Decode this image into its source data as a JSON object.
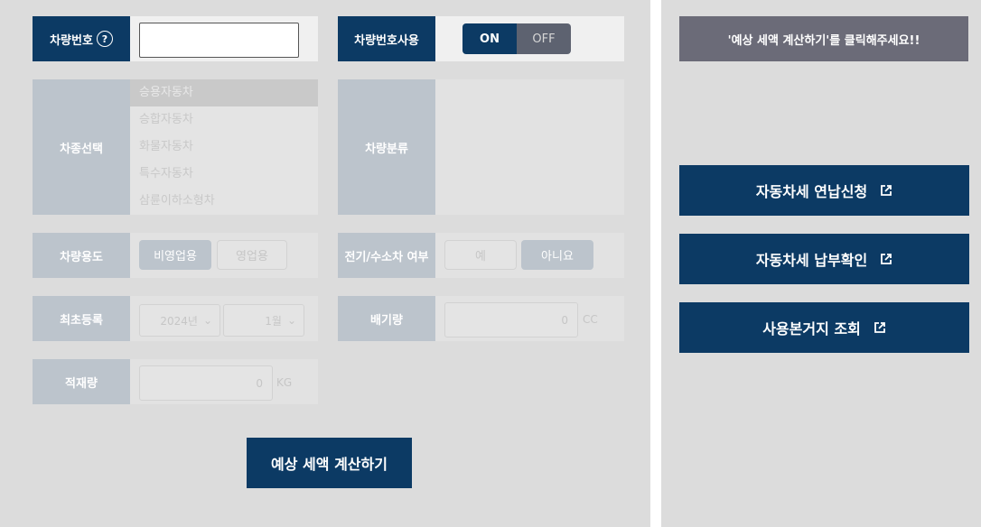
{
  "form": {
    "plate_label": "차량번호",
    "plate_value": "",
    "help_icon": "question-circle-icon",
    "use_plate_label": "차량번호사용",
    "toggle_on": "ON",
    "toggle_off": "OFF",
    "toggle_state": "ON",
    "car_type_label": "차종선택",
    "car_types": [
      "승용자동차",
      "승합자동차",
      "화물자동차",
      "특수자동차",
      "삼륜이하소형차"
    ],
    "car_type_selected": "승용자동차",
    "car_class_label": "차량분류",
    "purpose_label": "차량용도",
    "purpose_options": [
      "비영업용",
      "영업용"
    ],
    "purpose_selected": "비영업용",
    "ev_label": "전기/수소차 여부",
    "ev_options": [
      "예",
      "아니요"
    ],
    "ev_selected": "아니요",
    "first_reg_label": "최초등록",
    "year_value": "2024년",
    "month_value": "1월",
    "displacement_label": "배기량",
    "displacement_value": "0",
    "displacement_unit": "CC",
    "load_label": "적재량",
    "load_value": "0",
    "load_unit": "KG",
    "calc_button": "예상 세액 계산하기"
  },
  "sidebar": {
    "notice": "'예상 세액 계산하기'를 클릭해주세요!!",
    "links": [
      {
        "label": "자동차세 연납신청",
        "icon": "external-link-icon"
      },
      {
        "label": "자동차세 납부확인",
        "icon": "external-link-icon"
      },
      {
        "label": "사용본거지 조회",
        "icon": "external-link-icon"
      }
    ]
  },
  "colors": {
    "navy": "#0c3a64",
    "disabled_label": "#bcc4cc",
    "notice_bg": "#6b6b78"
  }
}
